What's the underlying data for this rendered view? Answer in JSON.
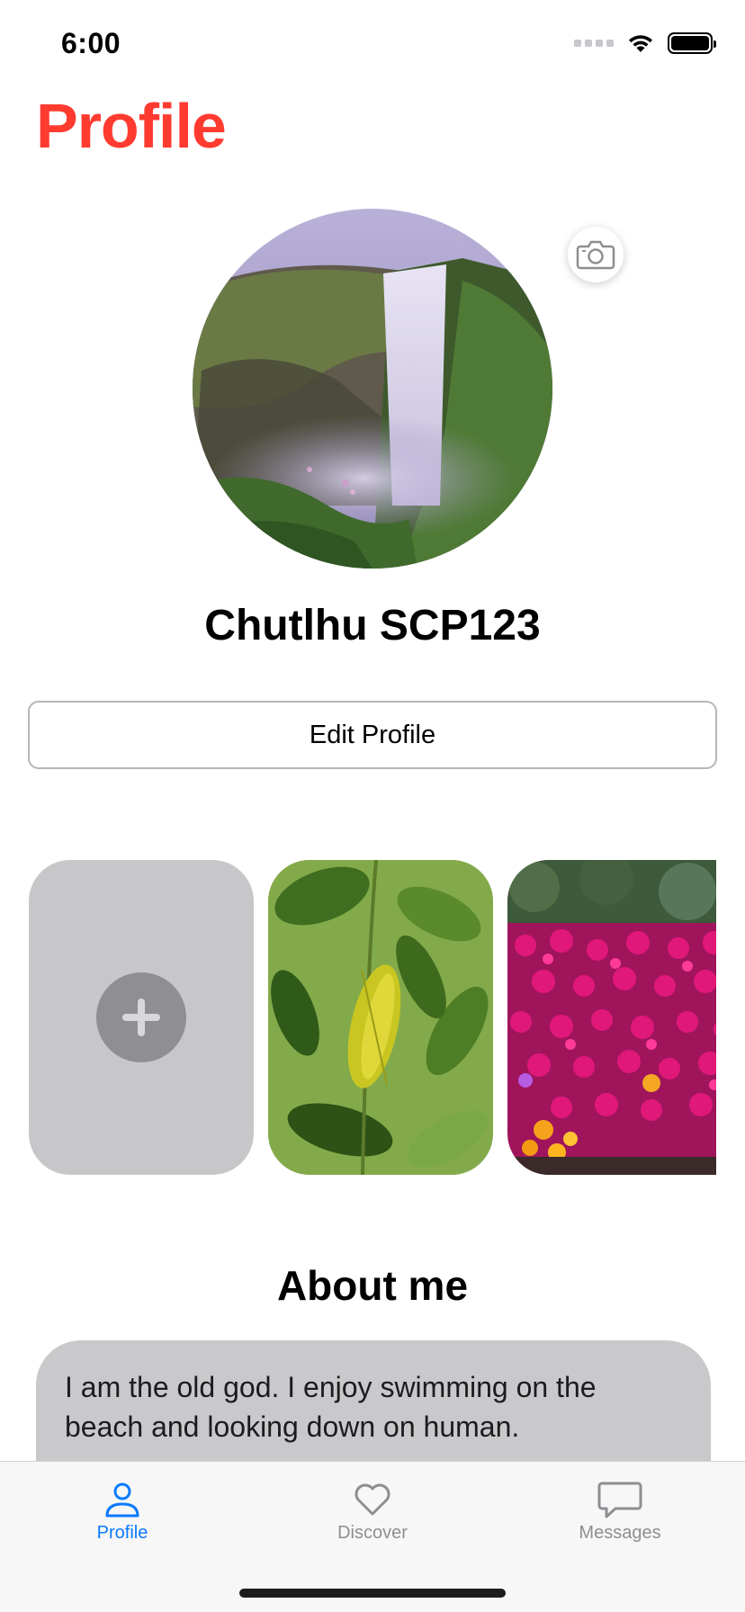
{
  "status_bar": {
    "time": "6:00"
  },
  "page": {
    "title": "Profile",
    "title_color": "#ff3b30"
  },
  "profile": {
    "avatar_icon": "waterfall-photo",
    "camera_icon": "camera-icon",
    "name": "Chutlhu SCP123",
    "edit_button_label": "Edit Profile"
  },
  "gallery": {
    "add_icon": "plus-icon",
    "photos": [
      {
        "subject": "citrus-leaves-photo"
      },
      {
        "subject": "magenta-flowers-photo"
      }
    ]
  },
  "about": {
    "heading": "About me",
    "text": "I am the old god. I enjoy swimming on the beach and looking down on human."
  },
  "tab_bar": {
    "active_color": "#0a7aff",
    "inactive_color": "#8e8e93",
    "tabs": [
      {
        "label": "Profile",
        "icon": "person-icon",
        "active": true
      },
      {
        "label": "Discover",
        "icon": "heart-icon",
        "active": false
      },
      {
        "label": "Messages",
        "icon": "message-bubble-icon",
        "active": false
      }
    ]
  }
}
